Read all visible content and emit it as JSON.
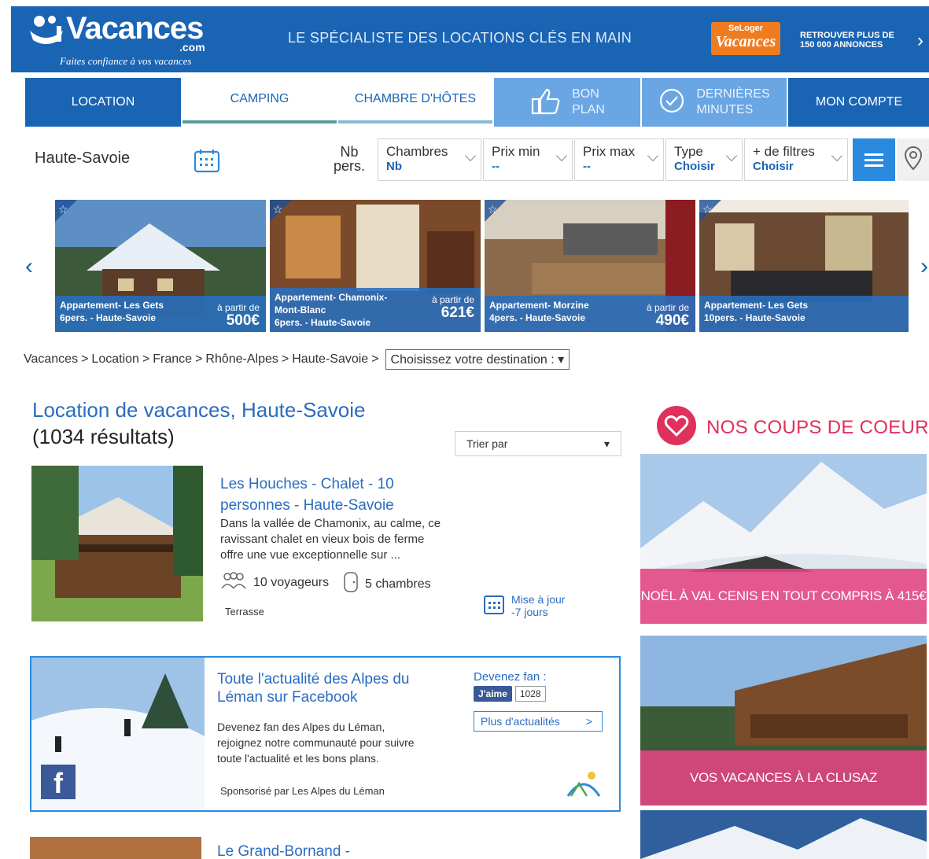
{
  "header": {
    "logo_name": "Vacances",
    "logo_suffix": ".com",
    "logo_tagline": "Faites confiance à vos vacances",
    "slogan": "LE SPÉCIALISTE DES LOCATIONS CLÉS EN MAIN",
    "partner_top": "SeLoger",
    "partner_bottom": "Vacances",
    "partner_text_1": "RETROUVER PLUS DE",
    "partner_text_2": "150 000 ANNONCES"
  },
  "nav": {
    "location": "LOCATION",
    "camping": "CAMPING",
    "chambre": "CHAMBRE D'HÔTES",
    "bonplan_1": "BON",
    "bonplan_2": "PLAN",
    "derniere_1": "DERNIÈRES",
    "derniere_2": "MINUTES",
    "compte": "MON COMPTE"
  },
  "search": {
    "destination": "Haute-Savoie",
    "nb_1": "Nb",
    "nb_2": "pers.",
    "filters": [
      {
        "label": "Chambres",
        "value": "Nb"
      },
      {
        "label": "Prix min",
        "value": "--"
      },
      {
        "label": "Prix max",
        "value": "--"
      },
      {
        "label": "Type",
        "value": "Choisir"
      },
      {
        "label": "+ de filtres",
        "value": "Choisir"
      }
    ]
  },
  "carousel": [
    {
      "line1": "Appartement- Les Gets",
      "line2": "6pers. - Haute-Savoie",
      "from": "à partir de",
      "price": "500€"
    },
    {
      "line1": "Appartement- Chamonix-",
      "line2": "Mont-Blanc",
      "line3": "6pers. - Haute-Savoie",
      "from": "à partir de",
      "price": "621€"
    },
    {
      "line1": "Appartement- Morzine",
      "line2": "4pers. - Haute-Savoie",
      "from": "à partir de",
      "price": "490€"
    },
    {
      "line1": "Appartement- Les Gets",
      "line2": "10pers. - Haute-Savoie"
    }
  ],
  "breadcrumb": {
    "items": [
      "Vacances",
      "Location",
      "France",
      "Rhône-Alpes",
      "Haute-Savoie"
    ],
    "separator": ">",
    "select": "Choisissez votre destination :"
  },
  "results": {
    "title": "Location de vacances, Haute-Savoie",
    "count": "(1034 résultats)",
    "sort_label": "Trier par"
  },
  "listing": {
    "title_1": "Les Houches - Chalet - 10",
    "title_2": "personnes - Haute-Savoie",
    "desc_1": "Dans la vallée de Chamonix, au calme, ce",
    "desc_2": "ravissant chalet en vieux bois de ferme",
    "desc_3": "offre une vue exceptionnelle sur ...",
    "guests": "10 voyageurs",
    "rooms": "5 chambres",
    "feature": "Terrasse",
    "update_1": "Mise à jour",
    "update_2": "-7 jours"
  },
  "facebook": {
    "title_1": "Toute l'actualité des Alpes du",
    "title_2": "Léman sur Facebook",
    "text_1": "Devenez fan des Alpes du Léman,",
    "text_2": "rejoignez notre communauté pour suivre",
    "text_3": "toute l'actualité et les bons plans.",
    "sponsor": "Sponsorisé par Les Alpes du Léman",
    "fan_label": "Devenez fan :",
    "like": "J'aime",
    "like_count": "1028",
    "more": "Plus d'actualités",
    "more_arrow": ">",
    "fb_letter": "f"
  },
  "next_listing": {
    "title": "Le Grand-Bornand -"
  },
  "sidebar": {
    "title": "NOS COUPS DE COEUR",
    "promos": [
      {
        "label": "NOËL À VAL CENIS EN TOUT COMPRIS À 415€"
      },
      {
        "label": "VOS VACANCES À LA CLUSAZ"
      }
    ]
  },
  "colors": {
    "brand_blue": "#1a64b4",
    "light_blue": "#6aa6e4",
    "link_blue": "#2a6cc0",
    "pink": "#e0305c",
    "orange": "#f07c22"
  }
}
